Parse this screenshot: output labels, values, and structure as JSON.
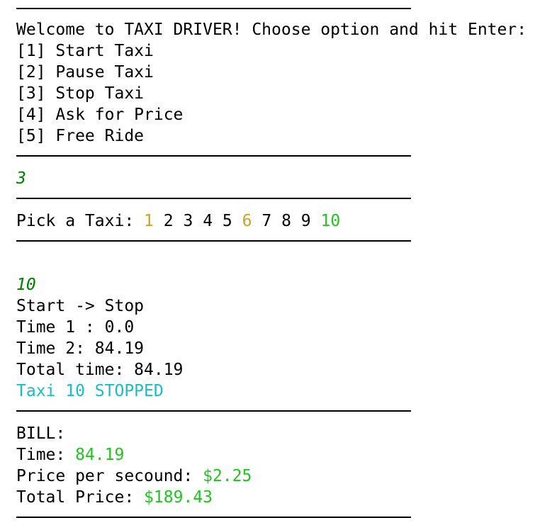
{
  "menu": {
    "welcome": "Welcome to TAXI DRIVER! Choose option and hit Enter:",
    "options": [
      "[1] Start Taxi",
      "[2] Pause Taxi",
      "[3] Stop Taxi",
      "[4] Ask for Price",
      "[5] Free Ride"
    ]
  },
  "first_input": "3",
  "pick": {
    "label": "Pick a Taxi:",
    "taxis": [
      "1",
      "2",
      "3",
      "4",
      "5",
      "6",
      "7",
      "8",
      "9",
      "10"
    ],
    "taxi_colors": {
      "busy": "#c9a227",
      "available": "#000000",
      "selected": "#22c422"
    }
  },
  "second_input": "10",
  "transition": "Start -> Stop",
  "time1": "Time 1 : 0.0",
  "time2": "Time 2: 84.19",
  "total_time": "Total time: 84.19",
  "status": "Taxi 10 STOPPED",
  "bill": {
    "header": "BILL:",
    "time_label": "Time:",
    "time_value": "84.19",
    "price_label": "Price per secound:",
    "price_value": "$2.25",
    "total_label": "Total Price:",
    "total_value": "$189.43"
  },
  "colors": {
    "input_echo": "#008000",
    "status_cyan": "#17bec8",
    "value_green": "#22c422"
  }
}
